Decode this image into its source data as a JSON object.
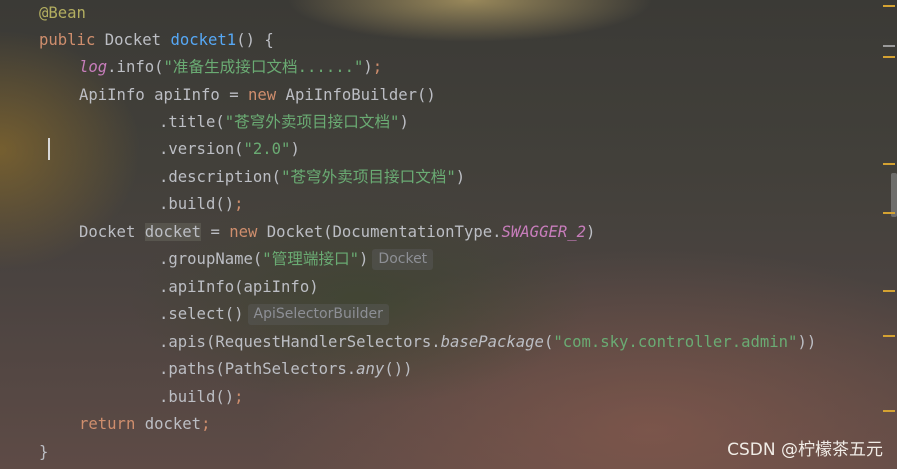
{
  "code": {
    "annotation": "@Bean",
    "l2": {
      "public": "public",
      "type": "Docket",
      "method": "docket1",
      "rest": "() {"
    },
    "l3": {
      "log": "log",
      "call": ".info(",
      "str": "\"准备生成接口文档......\"",
      "close": ")",
      "semi": ";"
    },
    "l4": {
      "decl": "ApiInfo apiInfo = ",
      "new": "new",
      "ctor": " ApiInfoBuilder()"
    },
    "l5": {
      "call": ".title(",
      "str": "\"苍穹外卖项目接口文档\"",
      "close": ")"
    },
    "l6": {
      "call": ".version(",
      "str": "\"2.0\"",
      "close": ")"
    },
    "l7": {
      "call": ".description(",
      "str": "\"苍穹外卖项目接口文档\"",
      "close": ")"
    },
    "l8": {
      "call": ".build()",
      "semi": ";"
    },
    "l9": {
      "type": "Docket ",
      "var": "docket",
      "eq": " = ",
      "new": "new",
      "ctor": " Docket(DocumentationType.",
      "const": "SWAGGER_2",
      "close": ")"
    },
    "l10": {
      "call": ".groupName(",
      "str": "\"管理端接口\"",
      "close": ")",
      "hint": "Docket"
    },
    "l11": {
      "call": ".apiInfo(apiInfo)"
    },
    "l12": {
      "call": ".select()",
      "hint": "ApiSelectorBuilder"
    },
    "l13": {
      "call": ".apis(RequestHandlerSelectors.",
      "static": "basePackage",
      "open": "(",
      "str": "\"com.sky.controller.admin\"",
      "close": "))"
    },
    "l14": {
      "call": ".paths(PathSelectors.",
      "static": "any",
      "close": "())"
    },
    "l15": {
      "call": ".build()",
      "semi": ";"
    },
    "l16": {
      "return": "return",
      "var": " docket",
      "semi": ";"
    },
    "l17": {
      "brace": "}"
    }
  },
  "watermark": "CSDN @柠檬茶五元",
  "colors": {
    "keyword": "#cf8e6d",
    "method": "#56a8f5",
    "annotation": "#b3ae60",
    "field": "#c77dbb",
    "string": "#6aab73",
    "text": "#bcbec4",
    "scroll_marker": "#d4a232"
  }
}
